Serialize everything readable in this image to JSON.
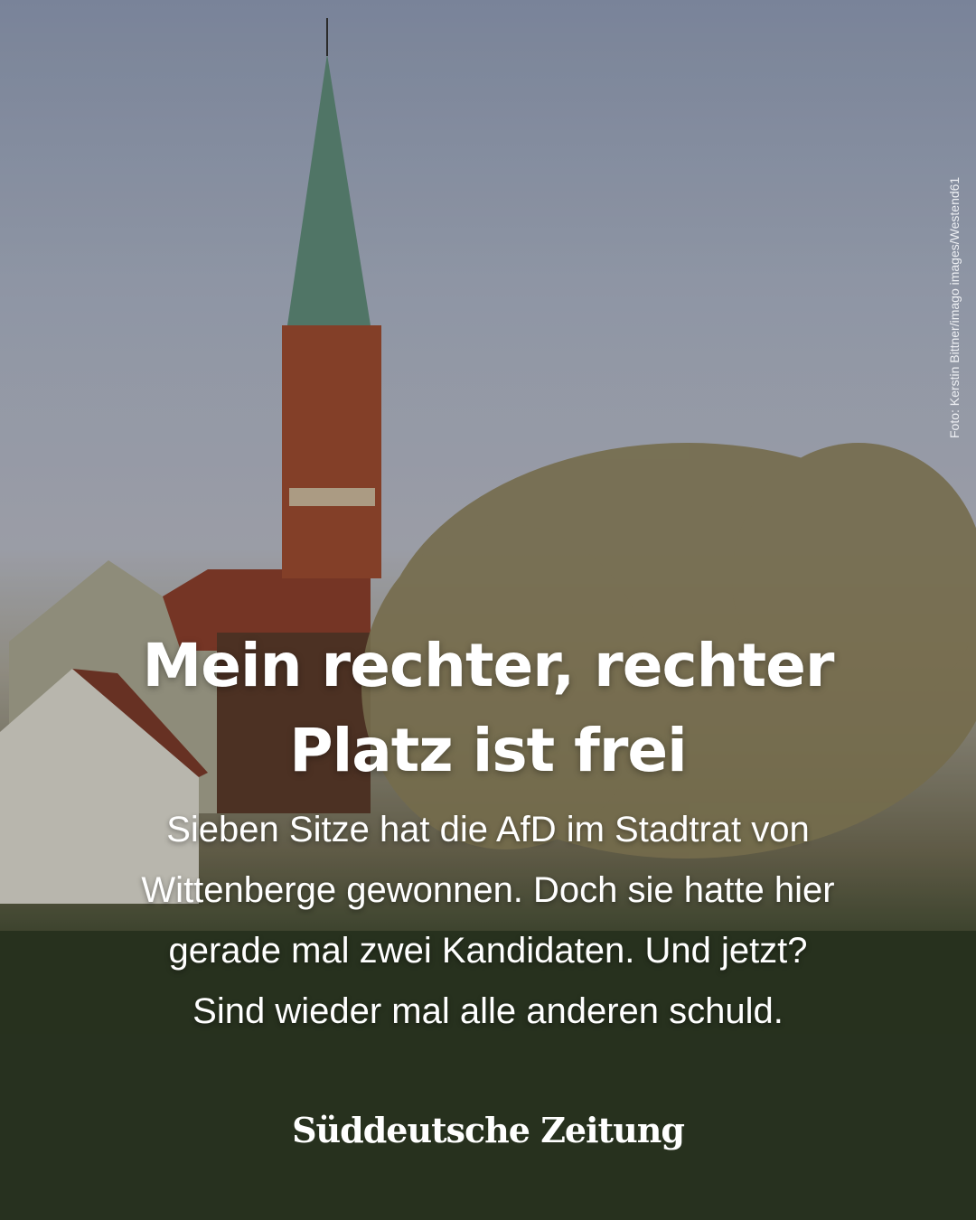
{
  "photo_credit": "Foto: Kerstin Bittner/imago images/Westend61",
  "headline": {
    "line1": "Mein rechter, rechter",
    "line2": "Platz ist frei"
  },
  "subtitle": {
    "line1": "Sieben Sitze hat die AfD im Stadtrat von",
    "line2": "Wittenberge gewonnen. Doch sie hatte hier",
    "line3": "gerade mal zwei Kandidaten. Und jetzt?",
    "line4": "Sind wieder mal alle anderen schuld."
  },
  "brand": "Süddeutsche Zeitung"
}
